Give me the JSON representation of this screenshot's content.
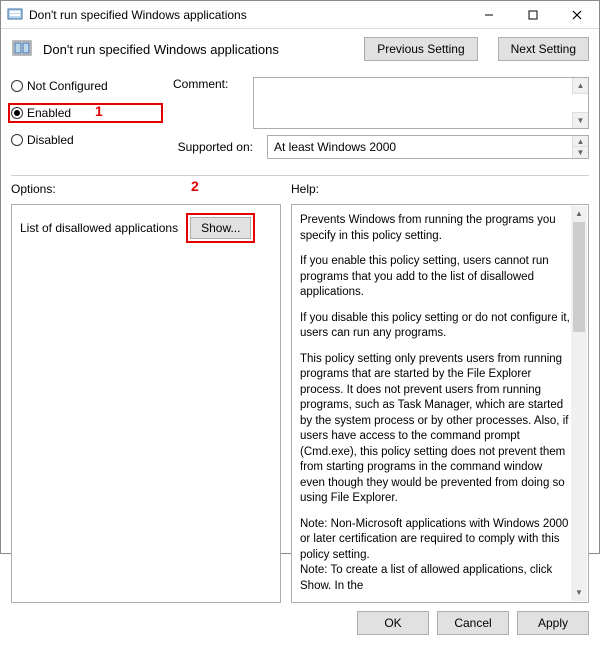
{
  "titlebar": {
    "title": "Don't run specified Windows applications"
  },
  "header": {
    "title": "Don't run specified Windows applications",
    "prev": "Previous Setting",
    "next": "Next Setting"
  },
  "radios": {
    "not_configured": "Not Configured",
    "enabled": "Enabled",
    "disabled": "Disabled"
  },
  "comment_label": "Comment:",
  "comment_value": "",
  "supported_label": "Supported on:",
  "supported_value": "At least Windows 2000",
  "options_label": "Options:",
  "help_label": "Help:",
  "options": {
    "list_label": "List of disallowed applications",
    "show": "Show..."
  },
  "help": {
    "p1": "Prevents Windows from running the programs you specify in this policy setting.",
    "p2": "If you enable this policy setting, users cannot run programs that you add to the list of disallowed applications.",
    "p3": "If you disable this policy setting or do not configure it, users can run any programs.",
    "p4": "This policy setting only prevents users from running programs that are started by the File Explorer process. It does not prevent users from running programs, such as Task Manager, which are started by the system process or by other processes.  Also, if users have access to the command prompt (Cmd.exe), this policy setting does not prevent them from starting programs in the command window even though they would be prevented from doing so using File Explorer.",
    "p5": "Note: Non-Microsoft applications with Windows 2000 or later certification are required to comply with this policy setting.",
    "p6": "Note: To create a list of allowed applications, click Show.  In the"
  },
  "annotations": {
    "one": "1",
    "two": "2"
  },
  "footer": {
    "ok": "OK",
    "cancel": "Cancel",
    "apply": "Apply"
  }
}
